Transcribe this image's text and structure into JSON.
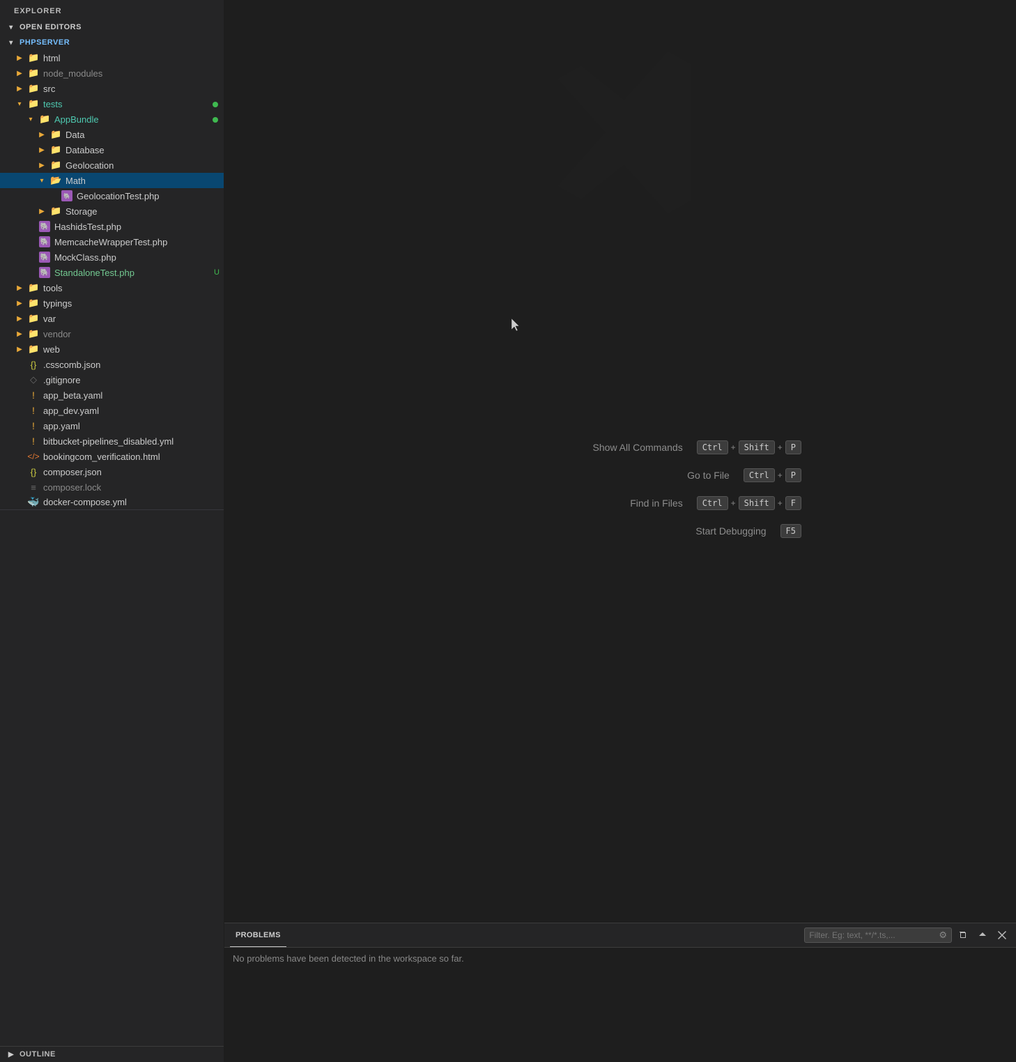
{
  "sidebar": {
    "explorer_title": "EXPLORER",
    "sections": {
      "open_editors": "OPEN EDITORS",
      "phpserver": "PHPSERVER",
      "outline": "OUTLINE"
    }
  },
  "file_tree": {
    "html": {
      "label": "html",
      "type": "folder",
      "indent": 1
    },
    "node_modules": {
      "label": "node_modules",
      "type": "folder",
      "indent": 1
    },
    "src": {
      "label": "src",
      "type": "folder",
      "indent": 1
    },
    "tests": {
      "label": "tests",
      "type": "folder",
      "indent": 1,
      "has_dot": true
    },
    "app_bundle": {
      "label": "AppBundle",
      "type": "folder",
      "indent": 2,
      "has_dot": true
    },
    "data": {
      "label": "Data",
      "type": "folder",
      "indent": 3
    },
    "database": {
      "label": "Database",
      "type": "folder",
      "indent": 3
    },
    "geolocation": {
      "label": "Geolocation",
      "type": "folder",
      "indent": 3
    },
    "math": {
      "label": "Math",
      "type": "folder_open",
      "indent": 3
    },
    "geolocation_test": {
      "label": "GeolocationTest.php",
      "type": "php",
      "indent": 4
    },
    "storage": {
      "label": "Storage",
      "type": "folder",
      "indent": 3
    },
    "hashids_test": {
      "label": "HashidsTest.php",
      "type": "php",
      "indent": 2
    },
    "memcache_test": {
      "label": "MemcacheWrapperTest.php",
      "type": "php",
      "indent": 2
    },
    "mock_class": {
      "label": "MockClass.php",
      "type": "php",
      "indent": 2
    },
    "standalone_test": {
      "label": "StandaloneTest.php",
      "type": "php",
      "indent": 2,
      "modified": "U"
    },
    "tools": {
      "label": "tools",
      "type": "folder",
      "indent": 1
    },
    "typings": {
      "label": "typings",
      "type": "folder",
      "indent": 1
    },
    "var": {
      "label": "var",
      "type": "folder",
      "indent": 1
    },
    "vendor": {
      "label": "vendor",
      "type": "folder",
      "indent": 1
    },
    "web": {
      "label": "web",
      "type": "folder",
      "indent": 1
    },
    "csscomb": {
      "label": ".csscomb.json",
      "type": "json",
      "indent": 1
    },
    "gitignore": {
      "label": ".gitignore",
      "type": "git",
      "indent": 1
    },
    "app_beta": {
      "label": "app_beta.yaml",
      "type": "yaml",
      "indent": 1
    },
    "app_dev": {
      "label": "app_dev.yaml",
      "type": "yaml",
      "indent": 1
    },
    "app_yaml": {
      "label": "app.yaml",
      "type": "yaml",
      "indent": 1
    },
    "bitbucket": {
      "label": "bitbucket-pipelines_disabled.yml",
      "type": "yaml",
      "indent": 1
    },
    "bookingcom": {
      "label": "bookingcom_verification.html",
      "type": "html",
      "indent": 1
    },
    "composer_json": {
      "label": "composer.json",
      "type": "json",
      "indent": 1
    },
    "composer_lock": {
      "label": "composer.lock",
      "type": "lock",
      "indent": 1
    },
    "docker": {
      "label": "docker-compose.yml",
      "type": "docker",
      "indent": 1
    }
  },
  "welcome": {
    "show_all_commands": "Show All Commands",
    "go_to_file": "Go to File",
    "find_in_files": "Find in Files",
    "start_debugging": "Start Debugging",
    "shortcuts": {
      "show_all_commands": [
        "Ctrl",
        "+",
        "Shift",
        "+",
        "P"
      ],
      "go_to_file": [
        "Ctrl",
        "+",
        "P"
      ],
      "find_in_files": [
        "Ctrl",
        "+",
        "Shift",
        "+",
        "F"
      ],
      "start_debugging": [
        "F5"
      ]
    }
  },
  "problems_panel": {
    "tab_label": "PROBLEMS",
    "more_label": "···",
    "filter_placeholder": "Filter. Eg: text, **/*.ts,...",
    "no_problems_message": "No problems have been detected in the workspace so far."
  },
  "colors": {
    "accent_blue": "#094771",
    "green_dot": "#3fb950",
    "php_purple": "#9b59b6",
    "modified_green": "#73c991",
    "text_muted": "#888888"
  }
}
